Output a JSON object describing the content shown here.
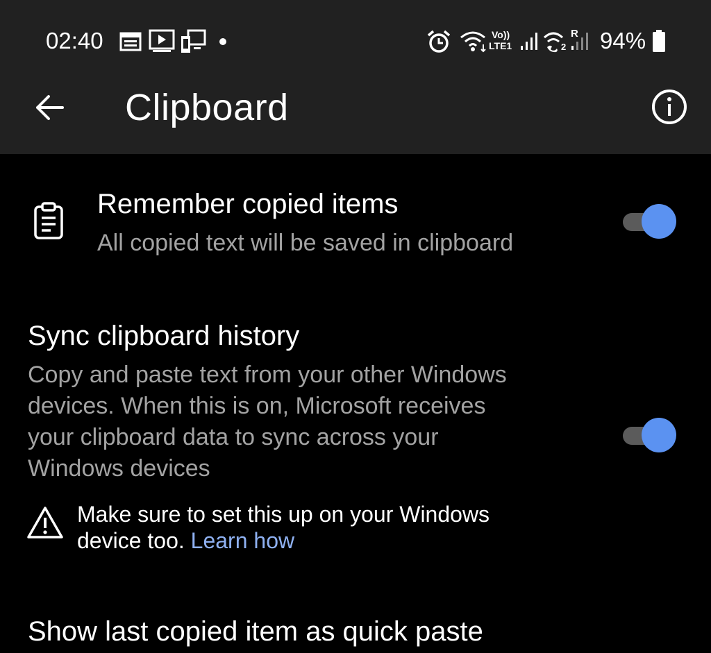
{
  "status_bar": {
    "time": "02:40",
    "battery": "94%",
    "net_volte": "Vo))",
    "net_lte": "LTE1",
    "sim2_label": "2",
    "roaming": "R",
    "icons": [
      "calendar-icon",
      "media-play-icon",
      "cast-icon",
      "dot-icon",
      "alarm-icon",
      "wifi-icon",
      "signal-icon",
      "wifi-calling-icon",
      "battery-icon"
    ]
  },
  "toolbar": {
    "title": "Clipboard",
    "icons": [
      "back-arrow-icon",
      "info-icon"
    ]
  },
  "settings": {
    "remember": {
      "title": "Remember copied items",
      "subtitle": "All copied text will be saved in clipboard",
      "on": true,
      "icon": "clipboard-icon"
    },
    "sync": {
      "title": "Sync clipboard history",
      "subtitle_lines": [
        "Copy and paste text from your other Windows",
        "devices. When this is on, Microsoft receives",
        "your clipboard data to sync across your",
        "Windows devices"
      ],
      "on": true
    },
    "warning": {
      "line1": "Make sure to set this up on your Windows",
      "line2": "device too.",
      "link": "Learn how",
      "icon": "warning-icon"
    },
    "quick_paste": {
      "title": "Show last copied item as quick paste"
    }
  },
  "colors": {
    "toolbar_bg": "#212121",
    "background": "#000000",
    "accent": "#5b92f1",
    "link": "#8fb1f2",
    "secondary_text": "#a3a3a3"
  }
}
